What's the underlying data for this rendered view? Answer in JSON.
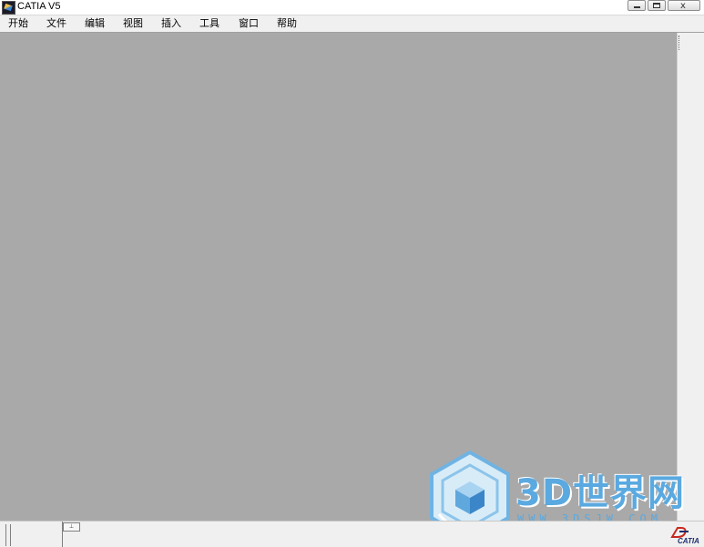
{
  "window": {
    "title": "CATIA V5",
    "buttons": {
      "minimize": "minimize",
      "maximize": "maximize",
      "close": "x"
    }
  },
  "menubar": {
    "items": [
      {
        "label": "开始"
      },
      {
        "label": "文件"
      },
      {
        "label": "编辑"
      },
      {
        "label": "视图"
      },
      {
        "label": "插入"
      },
      {
        "label": "工具"
      },
      {
        "label": "窗口"
      },
      {
        "label": "帮助"
      }
    ]
  },
  "workspace": {
    "background": "#a9a9a9"
  },
  "watermark": {
    "text": "3D世界网",
    "url": "WWW.3DSJW.COM",
    "color": "#5aa9e0"
  },
  "statusbar": {
    "tab_glyph": "⊥"
  },
  "brand": {
    "text": "CATIA"
  },
  "icons": [
    "catia-app-icon",
    "cube-logo-icon",
    "ds-catia-logo-icon"
  ]
}
